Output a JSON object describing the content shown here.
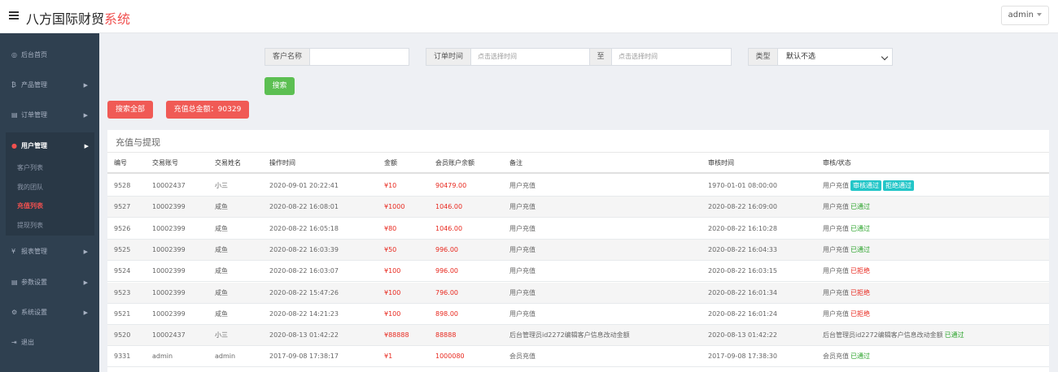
{
  "header": {
    "brand_main": "八方国际财贸",
    "brand_accent": "系统",
    "user": "admin"
  },
  "sidebar": {
    "items": [
      {
        "icon": "dashboard-icon",
        "glyph": "◎",
        "label": "后台首页"
      },
      {
        "icon": "bitcoin-icon",
        "glyph": "₿",
        "label": "产品管理"
      },
      {
        "icon": "files-icon",
        "glyph": "▤",
        "label": "订单管理"
      },
      {
        "icon": "user-icon",
        "glyph": "●",
        "label": "用户管理"
      },
      {
        "icon": "yen-icon",
        "glyph": "¥",
        "label": "报表管理"
      },
      {
        "icon": "copy-icon",
        "glyph": "▤",
        "label": "参数设置"
      },
      {
        "icon": "cogs-icon",
        "glyph": "⚙",
        "label": "系统设置"
      },
      {
        "icon": "logout-icon",
        "glyph": "⇥",
        "label": "退出"
      }
    ],
    "sub_items": [
      "客户列表",
      "我的团队",
      "充值列表",
      "提现列表"
    ]
  },
  "filters": {
    "customer_label": "客户名称",
    "customer_value": "",
    "order_time_label": "订单时间",
    "start_placeholder": "点击选择时间",
    "to_label": "至",
    "end_placeholder": "点击选择时间",
    "type_label": "类型",
    "type_selected": "默认不选",
    "search_button": "搜索"
  },
  "actions": {
    "search_all": "搜索全部",
    "total_recharge": "充值总金额：90329"
  },
  "panel": {
    "title": "充值与提现",
    "columns": [
      "编号",
      "交易账号",
      "交易姓名",
      "操作时间",
      "金额",
      "会员账户余额",
      "备注",
      "审核时间",
      "审核/状态"
    ],
    "approve_label": "审核通过",
    "reject_label": "拒绝通过",
    "rows": [
      {
        "id": "9528",
        "account": "10002437",
        "name": "小三",
        "time": "2020-09-01 20:22:41",
        "amount": "¥10",
        "balance": "90479.00",
        "note": "用户充值",
        "audit_time": "1970-01-01 08:00:00",
        "status_prefix": "用户充值",
        "status": "",
        "status_type": "pending"
      },
      {
        "id": "9527",
        "account": "10002399",
        "name": "咸鱼",
        "time": "2020-08-22 16:08:01",
        "amount": "¥1000",
        "balance": "1046.00",
        "note": "用户充值",
        "audit_time": "2020-08-22 16:09:00",
        "status_prefix": "用户充值",
        "status": "已通过",
        "status_type": "ok"
      },
      {
        "id": "9526",
        "account": "10002399",
        "name": "咸鱼",
        "time": "2020-08-22 16:05:18",
        "amount": "¥80",
        "balance": "1046.00",
        "note": "用户充值",
        "audit_time": "2020-08-22 16:10:28",
        "status_prefix": "用户充值",
        "status": "已通过",
        "status_type": "ok"
      },
      {
        "id": "9525",
        "account": "10002399",
        "name": "咸鱼",
        "time": "2020-08-22 16:03:39",
        "amount": "¥50",
        "balance": "996.00",
        "note": "用户充值",
        "audit_time": "2020-08-22 16:04:33",
        "status_prefix": "用户充值",
        "status": "已通过",
        "status_type": "ok"
      },
      {
        "id": "9524",
        "account": "10002399",
        "name": "咸鱼",
        "time": "2020-08-22 16:03:07",
        "amount": "¥100",
        "balance": "996.00",
        "note": "用户充值",
        "audit_time": "2020-08-22 16:03:15",
        "status_prefix": "用户充值",
        "status": "已拒绝",
        "status_type": "bad"
      },
      {
        "id": "9523",
        "account": "10002399",
        "name": "咸鱼",
        "time": "2020-08-22 15:47:26",
        "amount": "¥100",
        "balance": "796.00",
        "note": "用户充值",
        "audit_time": "2020-08-22 16:01:34",
        "status_prefix": "用户充值",
        "status": "已拒绝",
        "status_type": "bad"
      },
      {
        "id": "9521",
        "account": "10002399",
        "name": "咸鱼",
        "time": "2020-08-22 14:21:23",
        "amount": "¥100",
        "balance": "898.00",
        "note": "用户充值",
        "audit_time": "2020-08-22 16:01:24",
        "status_prefix": "用户充值",
        "status": "已拒绝",
        "status_type": "bad"
      },
      {
        "id": "9520",
        "account": "10002437",
        "name": "小三",
        "time": "2020-08-13 01:42:22",
        "amount": "¥88888",
        "balance": "88888",
        "note": "后台管理员id2272编辑客户信息改动金额",
        "audit_time": "2020-08-13 01:42:22",
        "status_prefix": "后台管理员id2272编辑客户信息改动金额",
        "status": "已通过",
        "status_type": "ok"
      },
      {
        "id": "9331",
        "account": "admin",
        "name": "admin",
        "time": "2017-09-08 17:38:17",
        "amount": "¥1",
        "balance": "1000080",
        "note": "会员充值",
        "audit_time": "2017-09-08 17:38:30",
        "status_prefix": "会员充值",
        "status": "已通过",
        "status_type": "ok"
      }
    ]
  }
}
